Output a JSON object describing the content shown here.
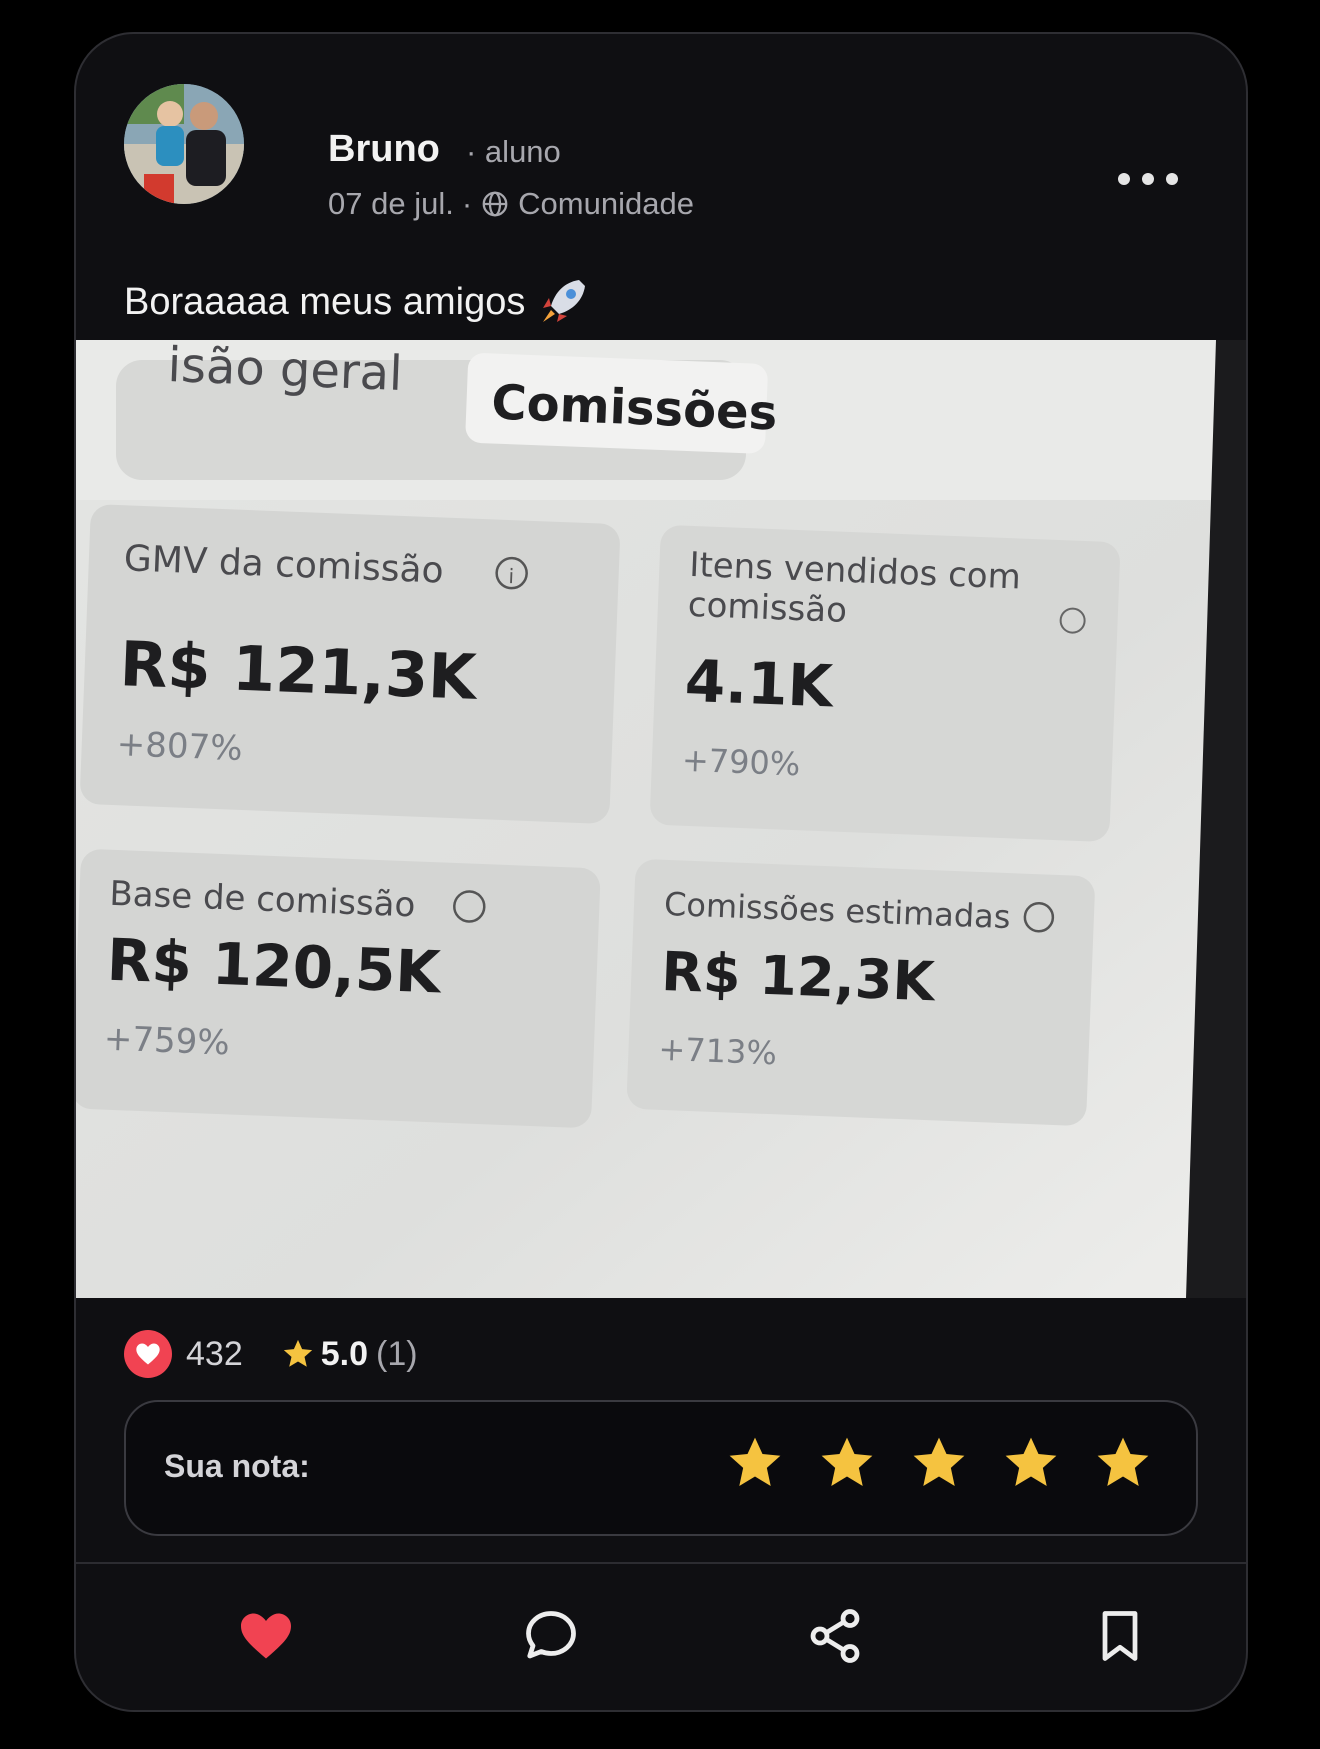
{
  "post": {
    "author": "Bruno",
    "role": "· aluno",
    "date": "07 de jul.",
    "separator": "·",
    "audience": "Comunidade",
    "caption": "Boraaaaa meus amigos"
  },
  "photo": {
    "tab_inactive": "isão geral",
    "tab_active": "Comissões",
    "cards": [
      {
        "title": "GMV da comissão",
        "value": "R$ 121,3K",
        "change": "+807%"
      },
      {
        "title_line1": "Itens vendidos com",
        "title_line2": "comissão",
        "value": "4.1K",
        "change": "+790%"
      },
      {
        "title": "Base de comissão",
        "value": "R$ 120,5K",
        "change": "+759%"
      },
      {
        "title": "Comissões estimadas",
        "value": "R$ 12,3K",
        "change": "+713%"
      }
    ]
  },
  "stats": {
    "likes": "432",
    "rating": "5.0",
    "rating_count": "(1)"
  },
  "rate": {
    "label": "Sua nota:",
    "stars": 5
  },
  "icons": {
    "more": "more-horizontal-icon",
    "globe": "globe-icon",
    "rocket": "rocket-icon",
    "like": "heart-icon",
    "comment": "comment-icon",
    "share": "share-icon",
    "bookmark": "bookmark-icon"
  },
  "colors": {
    "background": "#000000",
    "card": "#0f0f12",
    "heart": "#f14352",
    "star": "#f5c340",
    "text": "#f2f2f2",
    "muted": "#a7a7ad"
  }
}
